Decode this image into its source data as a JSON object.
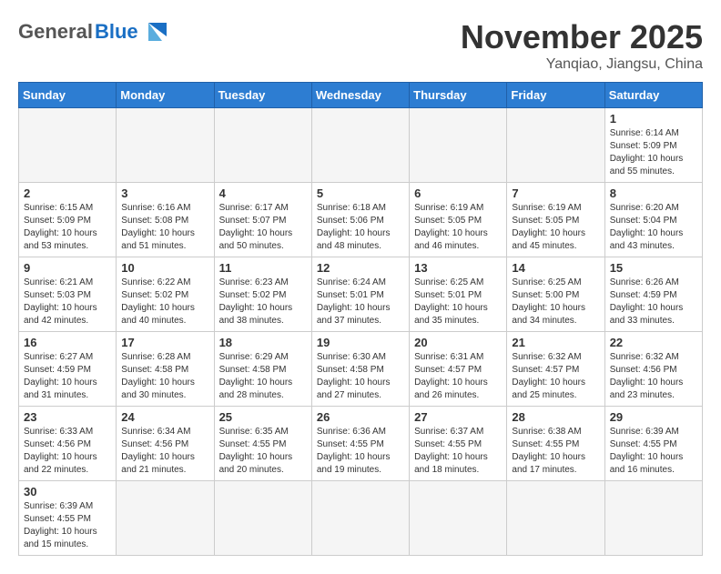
{
  "header": {
    "logo_general": "General",
    "logo_blue": "Blue",
    "month_title": "November 2025",
    "location": "Yanqiao, Jiangsu, China"
  },
  "weekdays": [
    "Sunday",
    "Monday",
    "Tuesday",
    "Wednesday",
    "Thursday",
    "Friday",
    "Saturday"
  ],
  "days": {
    "d1": {
      "num": "1",
      "info": "Sunrise: 6:14 AM\nSunset: 5:09 PM\nDaylight: 10 hours and 55 minutes."
    },
    "d2": {
      "num": "2",
      "info": "Sunrise: 6:15 AM\nSunset: 5:09 PM\nDaylight: 10 hours and 53 minutes."
    },
    "d3": {
      "num": "3",
      "info": "Sunrise: 6:16 AM\nSunset: 5:08 PM\nDaylight: 10 hours and 51 minutes."
    },
    "d4": {
      "num": "4",
      "info": "Sunrise: 6:17 AM\nSunset: 5:07 PM\nDaylight: 10 hours and 50 minutes."
    },
    "d5": {
      "num": "5",
      "info": "Sunrise: 6:18 AM\nSunset: 5:06 PM\nDaylight: 10 hours and 48 minutes."
    },
    "d6": {
      "num": "6",
      "info": "Sunrise: 6:19 AM\nSunset: 5:05 PM\nDaylight: 10 hours and 46 minutes."
    },
    "d7": {
      "num": "7",
      "info": "Sunrise: 6:19 AM\nSunset: 5:05 PM\nDaylight: 10 hours and 45 minutes."
    },
    "d8": {
      "num": "8",
      "info": "Sunrise: 6:20 AM\nSunset: 5:04 PM\nDaylight: 10 hours and 43 minutes."
    },
    "d9": {
      "num": "9",
      "info": "Sunrise: 6:21 AM\nSunset: 5:03 PM\nDaylight: 10 hours and 42 minutes."
    },
    "d10": {
      "num": "10",
      "info": "Sunrise: 6:22 AM\nSunset: 5:02 PM\nDaylight: 10 hours and 40 minutes."
    },
    "d11": {
      "num": "11",
      "info": "Sunrise: 6:23 AM\nSunset: 5:02 PM\nDaylight: 10 hours and 38 minutes."
    },
    "d12": {
      "num": "12",
      "info": "Sunrise: 6:24 AM\nSunset: 5:01 PM\nDaylight: 10 hours and 37 minutes."
    },
    "d13": {
      "num": "13",
      "info": "Sunrise: 6:25 AM\nSunset: 5:01 PM\nDaylight: 10 hours and 35 minutes."
    },
    "d14": {
      "num": "14",
      "info": "Sunrise: 6:25 AM\nSunset: 5:00 PM\nDaylight: 10 hours and 34 minutes."
    },
    "d15": {
      "num": "15",
      "info": "Sunrise: 6:26 AM\nSunset: 4:59 PM\nDaylight: 10 hours and 33 minutes."
    },
    "d16": {
      "num": "16",
      "info": "Sunrise: 6:27 AM\nSunset: 4:59 PM\nDaylight: 10 hours and 31 minutes."
    },
    "d17": {
      "num": "17",
      "info": "Sunrise: 6:28 AM\nSunset: 4:58 PM\nDaylight: 10 hours and 30 minutes."
    },
    "d18": {
      "num": "18",
      "info": "Sunrise: 6:29 AM\nSunset: 4:58 PM\nDaylight: 10 hours and 28 minutes."
    },
    "d19": {
      "num": "19",
      "info": "Sunrise: 6:30 AM\nSunset: 4:58 PM\nDaylight: 10 hours and 27 minutes."
    },
    "d20": {
      "num": "20",
      "info": "Sunrise: 6:31 AM\nSunset: 4:57 PM\nDaylight: 10 hours and 26 minutes."
    },
    "d21": {
      "num": "21",
      "info": "Sunrise: 6:32 AM\nSunset: 4:57 PM\nDaylight: 10 hours and 25 minutes."
    },
    "d22": {
      "num": "22",
      "info": "Sunrise: 6:32 AM\nSunset: 4:56 PM\nDaylight: 10 hours and 23 minutes."
    },
    "d23": {
      "num": "23",
      "info": "Sunrise: 6:33 AM\nSunset: 4:56 PM\nDaylight: 10 hours and 22 minutes."
    },
    "d24": {
      "num": "24",
      "info": "Sunrise: 6:34 AM\nSunset: 4:56 PM\nDaylight: 10 hours and 21 minutes."
    },
    "d25": {
      "num": "25",
      "info": "Sunrise: 6:35 AM\nSunset: 4:55 PM\nDaylight: 10 hours and 20 minutes."
    },
    "d26": {
      "num": "26",
      "info": "Sunrise: 6:36 AM\nSunset: 4:55 PM\nDaylight: 10 hours and 19 minutes."
    },
    "d27": {
      "num": "27",
      "info": "Sunrise: 6:37 AM\nSunset: 4:55 PM\nDaylight: 10 hours and 18 minutes."
    },
    "d28": {
      "num": "28",
      "info": "Sunrise: 6:38 AM\nSunset: 4:55 PM\nDaylight: 10 hours and 17 minutes."
    },
    "d29": {
      "num": "29",
      "info": "Sunrise: 6:39 AM\nSunset: 4:55 PM\nDaylight: 10 hours and 16 minutes."
    },
    "d30": {
      "num": "30",
      "info": "Sunrise: 6:39 AM\nSunset: 4:55 PM\nDaylight: 10 hours and 15 minutes."
    }
  }
}
